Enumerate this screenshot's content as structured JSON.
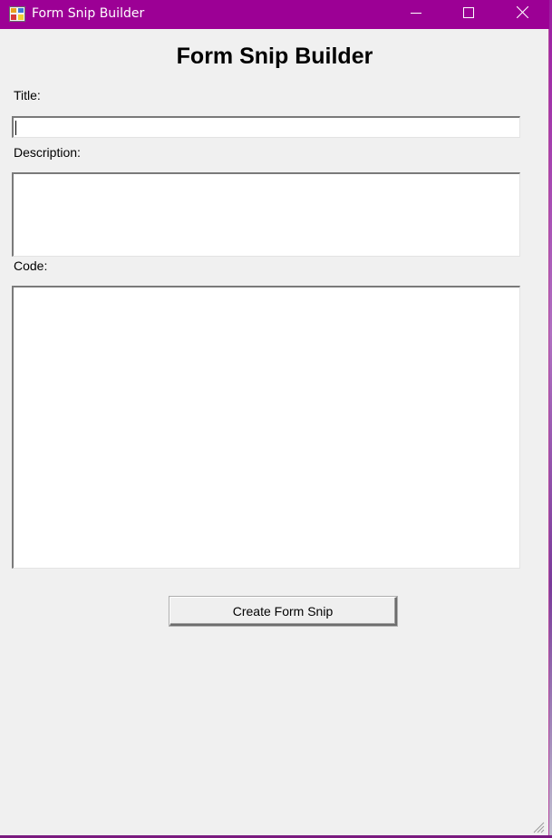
{
  "window": {
    "title": "Form Snip Builder",
    "icon": "app-form-icon",
    "controls": [
      "minimize-icon",
      "maximize-icon",
      "close-icon"
    ],
    "titlebar_color": "#9c0095"
  },
  "form": {
    "heading": "Form Snip Builder",
    "title_label": "Title:",
    "title_value": "",
    "description_label": "Description:",
    "description_value": "",
    "code_label": "Code:",
    "code_value": "",
    "create_button_label": "Create Form Snip"
  }
}
